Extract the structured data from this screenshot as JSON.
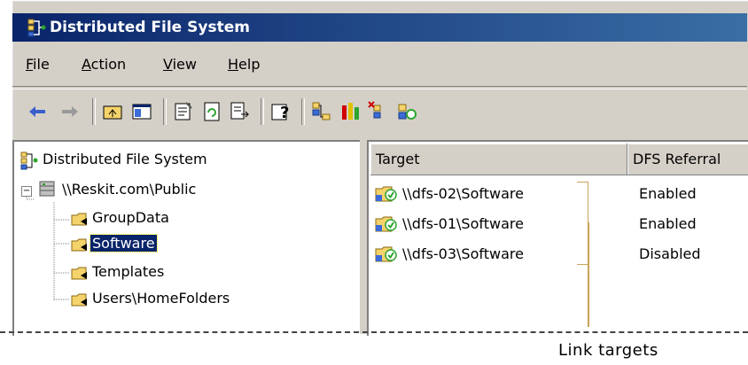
{
  "window": {
    "title": "Distributed File System",
    "icon": "dfs-icon"
  },
  "menu": [
    {
      "underline": "F",
      "rest": "ile"
    },
    {
      "underline": "A",
      "rest": "ction"
    },
    {
      "underline": "V",
      "rest": "iew"
    },
    {
      "underline": "H",
      "rest": "elp"
    }
  ],
  "toolbar": {
    "icons": [
      "back-arrow-icon",
      "forward-arrow-icon",
      "up-folder-icon",
      "show-hide-tree-icon",
      "properties-icon",
      "refresh-icon",
      "export-list-icon",
      "help-icon",
      "new-root-icon",
      "status-icon",
      "remove-root-icon",
      "check-status-icon"
    ]
  },
  "tree": {
    "root": "Distributed File System",
    "namespace": "\\\\Reskit.com\\Public",
    "links": [
      "GroupData",
      "Software",
      "Templates",
      "Users\\HomeFolders"
    ],
    "selected": "Software"
  },
  "list": {
    "columns": [
      "Target",
      "DFS Referral"
    ],
    "rows": [
      {
        "target": "\\\\dfs-02\\Software",
        "referral": "Enabled"
      },
      {
        "target": "\\\\dfs-01\\Software",
        "referral": "Enabled"
      },
      {
        "target": "\\\\dfs-03\\Software",
        "referral": "Disabled"
      }
    ]
  },
  "callout": {
    "text": "Link targets",
    "color": "#c7a35a"
  },
  "colors": {
    "titlebar_start": "#0a246a",
    "titlebar_end": "#3a6ea5",
    "chrome": "#d4d0c8"
  }
}
